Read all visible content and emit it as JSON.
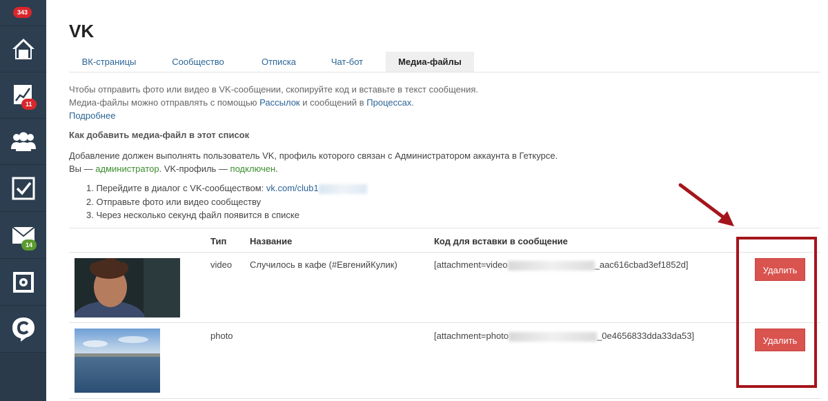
{
  "sidebar": {
    "top_badge": "343",
    "items": [
      {
        "icon": "home-icon"
      },
      {
        "icon": "chart-icon",
        "badge": "11"
      },
      {
        "icon": "users-icon"
      },
      {
        "icon": "checkbox-icon"
      },
      {
        "icon": "mail-icon",
        "badge": "14"
      },
      {
        "icon": "safe-icon"
      },
      {
        "icon": "chat-logo-icon"
      }
    ]
  },
  "page": {
    "title": "VK",
    "tabs": [
      "ВК-страницы",
      "Сообщество",
      "Отписка",
      "Чат-бот",
      "Медиа-файлы"
    ],
    "active_tab": "Медиа-файлы"
  },
  "intro": {
    "line1": "Чтобы отправить фото или видео в VK-сообщении, скопируйте код и вставьте в текст сообщения.",
    "line2_a": "Медиа-файлы можно отправлять с помощью ",
    "line2_link1": "Рассылок",
    "line2_b": " и сообщений в ",
    "line2_link2": "Процессах",
    "line2_c": ".",
    "more_link": "Подробнее"
  },
  "howto": {
    "heading": "Как добавить медиа-файл в этот список",
    "para1": "Добавление должен выполнять пользователь VK, профиль которого связан с Администратором аккаунта в Геткурсе.",
    "you_prefix": "Вы — ",
    "you_role": "администратор",
    "profile_prefix": ". VK-профиль — ",
    "profile_status": "подключен",
    "profile_suffix": ".",
    "step1_prefix": "1. Перейдите в диалог с VK-сообществом: ",
    "step1_link": "vk.com/club1",
    "step2": "2. Отправьте фото или видео сообществу",
    "step3": "3. Через несколько секунд файл появится в списке"
  },
  "table": {
    "headers": {
      "type": "Тип",
      "name": "Название",
      "code": "Код для вставки в сообщение"
    },
    "rows": [
      {
        "type": "video",
        "name": "Случилось в кафе (#ЕвгенийКулик)",
        "code_prefix": "[attachment=video",
        "code_suffix": "_aac616cbad3ef1852d]",
        "delete_label": "Удалить"
      },
      {
        "type": "photo",
        "name": "",
        "code_prefix": "[attachment=photo",
        "code_suffix": "_0e4656833dda33da53]",
        "delete_label": "Удалить"
      }
    ]
  },
  "colors": {
    "sidebar": "#2d3e50",
    "link": "#2a6496",
    "delete": "#d9534f",
    "highlight": "#a4151b",
    "status_green": "#3c8d2f"
  }
}
